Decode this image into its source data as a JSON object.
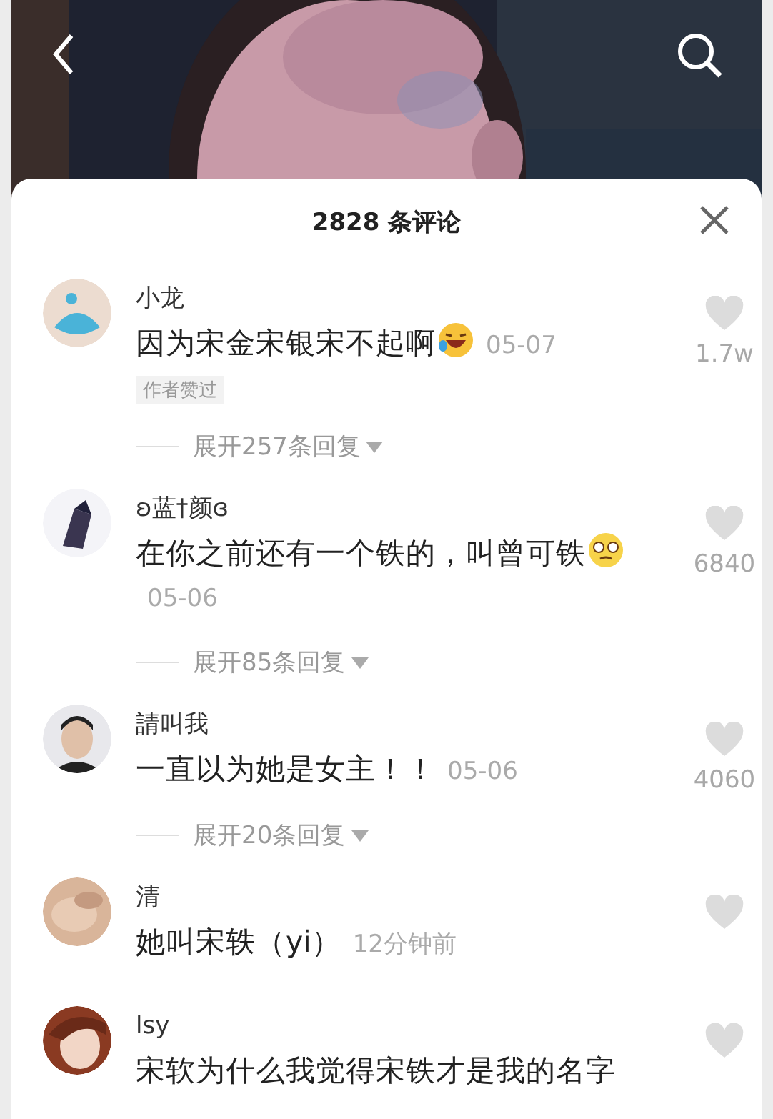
{
  "comments_panel": {
    "title": "2828 条评论"
  },
  "comments": [
    {
      "user": "小龙",
      "text": "因为宋金宋银宋不起啊",
      "emoji": {
        "kind": "laugh"
      },
      "time": "05-07",
      "badge": "作者赞过",
      "likes": "1.7w",
      "replies": "展开257条回复"
    },
    {
      "user": "ʚ蓝†颜ɞ",
      "text": "在你之前还有一个铁的，叫曾可铁",
      "emoji": {
        "kind": "pleading"
      },
      "time": "05-06",
      "likes": "6840",
      "replies": "展开85条回复"
    },
    {
      "user": "請叫我",
      "text": "一直以为她是女主！！",
      "time": "05-06",
      "likes": "4060",
      "replies": "展开20条回复"
    },
    {
      "user": "清",
      "text": "她叫宋轶（yi）",
      "time": "12分钟前"
    },
    {
      "user": "lsy",
      "text": "宋软为什么我觉得宋铁才是我的名字"
    }
  ]
}
